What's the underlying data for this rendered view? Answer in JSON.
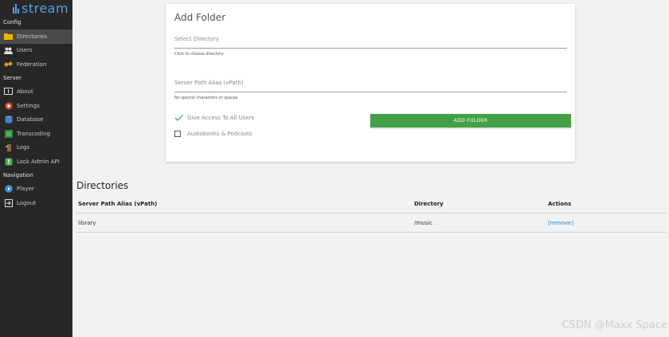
{
  "sidebar": {
    "logo": "stream",
    "sections": {
      "config": "Config",
      "server": "Server",
      "navigation": "Navigation"
    },
    "config_items": [
      {
        "label": "Directories",
        "icon": "folder-icon"
      },
      {
        "label": "Users",
        "icon": "users-icon"
      },
      {
        "label": "Federation",
        "icon": "federation-icon"
      }
    ],
    "server_items": [
      {
        "label": "About",
        "icon": "about-icon"
      },
      {
        "label": "Settings",
        "icon": "gear-icon"
      },
      {
        "label": "Database",
        "icon": "database-icon"
      },
      {
        "label": "Transcoding",
        "icon": "transcoding-icon"
      },
      {
        "label": "Logs",
        "icon": "logs-icon"
      },
      {
        "label": "Lock Admin API",
        "icon": "lock-icon"
      }
    ],
    "navigation_items": [
      {
        "label": "Player",
        "icon": "play-icon"
      },
      {
        "label": "Logout",
        "icon": "logout-icon"
      }
    ]
  },
  "add_folder": {
    "title": "Add Folder",
    "directory_placeholder": "Select Directory",
    "directory_hint": "Click to choose directory",
    "vpath_placeholder": "Server Path Alias (vPath)",
    "vpath_hint": "No special characters or spaces",
    "access_all_label": "Give Access To All Users",
    "audiobooks_label": "Audiobooks & Podcasts",
    "submit_label": "ADD FOLDER"
  },
  "directories": {
    "title": "Directories",
    "headers": [
      "Server Path Alias (vPath)",
      "Directory",
      "Actions"
    ],
    "rows": [
      {
        "vpath": "library",
        "directory": "/music",
        "action": "[remove]"
      }
    ]
  },
  "watermark": "CSDN @Maxx Space",
  "colors": {
    "sidebar_bg": "#272727",
    "accent": "#5aa0e0",
    "button_green": "#43a047",
    "link": "#2a88c8"
  }
}
